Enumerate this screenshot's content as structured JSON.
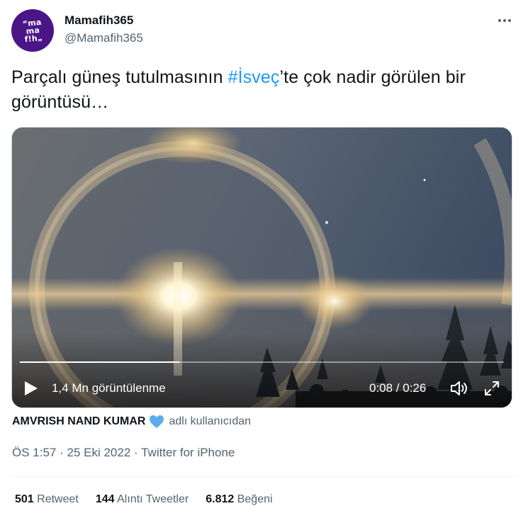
{
  "author": {
    "display_name": "Mamafih365",
    "handle": "@Mamafih365",
    "avatar_text": [
      "“ma",
      "ma",
      "f!h„"
    ]
  },
  "tweet": {
    "text_before": "Parçalı güneş tutulmasının ",
    "hashtag": "#İsveç",
    "text_after": "’te çok nadir görülen bir görüntüsü…"
  },
  "video": {
    "views": "1,4 Mn görüntülenme",
    "time": "0:08 / 0:26",
    "progress": 0.33
  },
  "attribution": {
    "name": "AMVRISH NAND KUMAR",
    "suffix": "adlı kullanıcıdan"
  },
  "meta": {
    "time": "ÖS 1:57",
    "date": "25 Eki 2022",
    "source": "Twitter for iPhone",
    "separator": " · "
  },
  "stats": [
    {
      "value": "501",
      "label": "Retweet"
    },
    {
      "value": "144",
      "label": "Alıntı Tweetler"
    },
    {
      "value": "6.812",
      "label": "Beğeni"
    }
  ],
  "colors": {
    "accent": "#1d9bf0",
    "avatar_bg": "#4a1587",
    "secondary_text": "#536471"
  },
  "icons": {
    "more": "more-horizontal-icon",
    "play": "play-icon",
    "volume": "volume-icon",
    "fullscreen": "fullscreen-icon",
    "heart": "blue-heart-icon"
  }
}
